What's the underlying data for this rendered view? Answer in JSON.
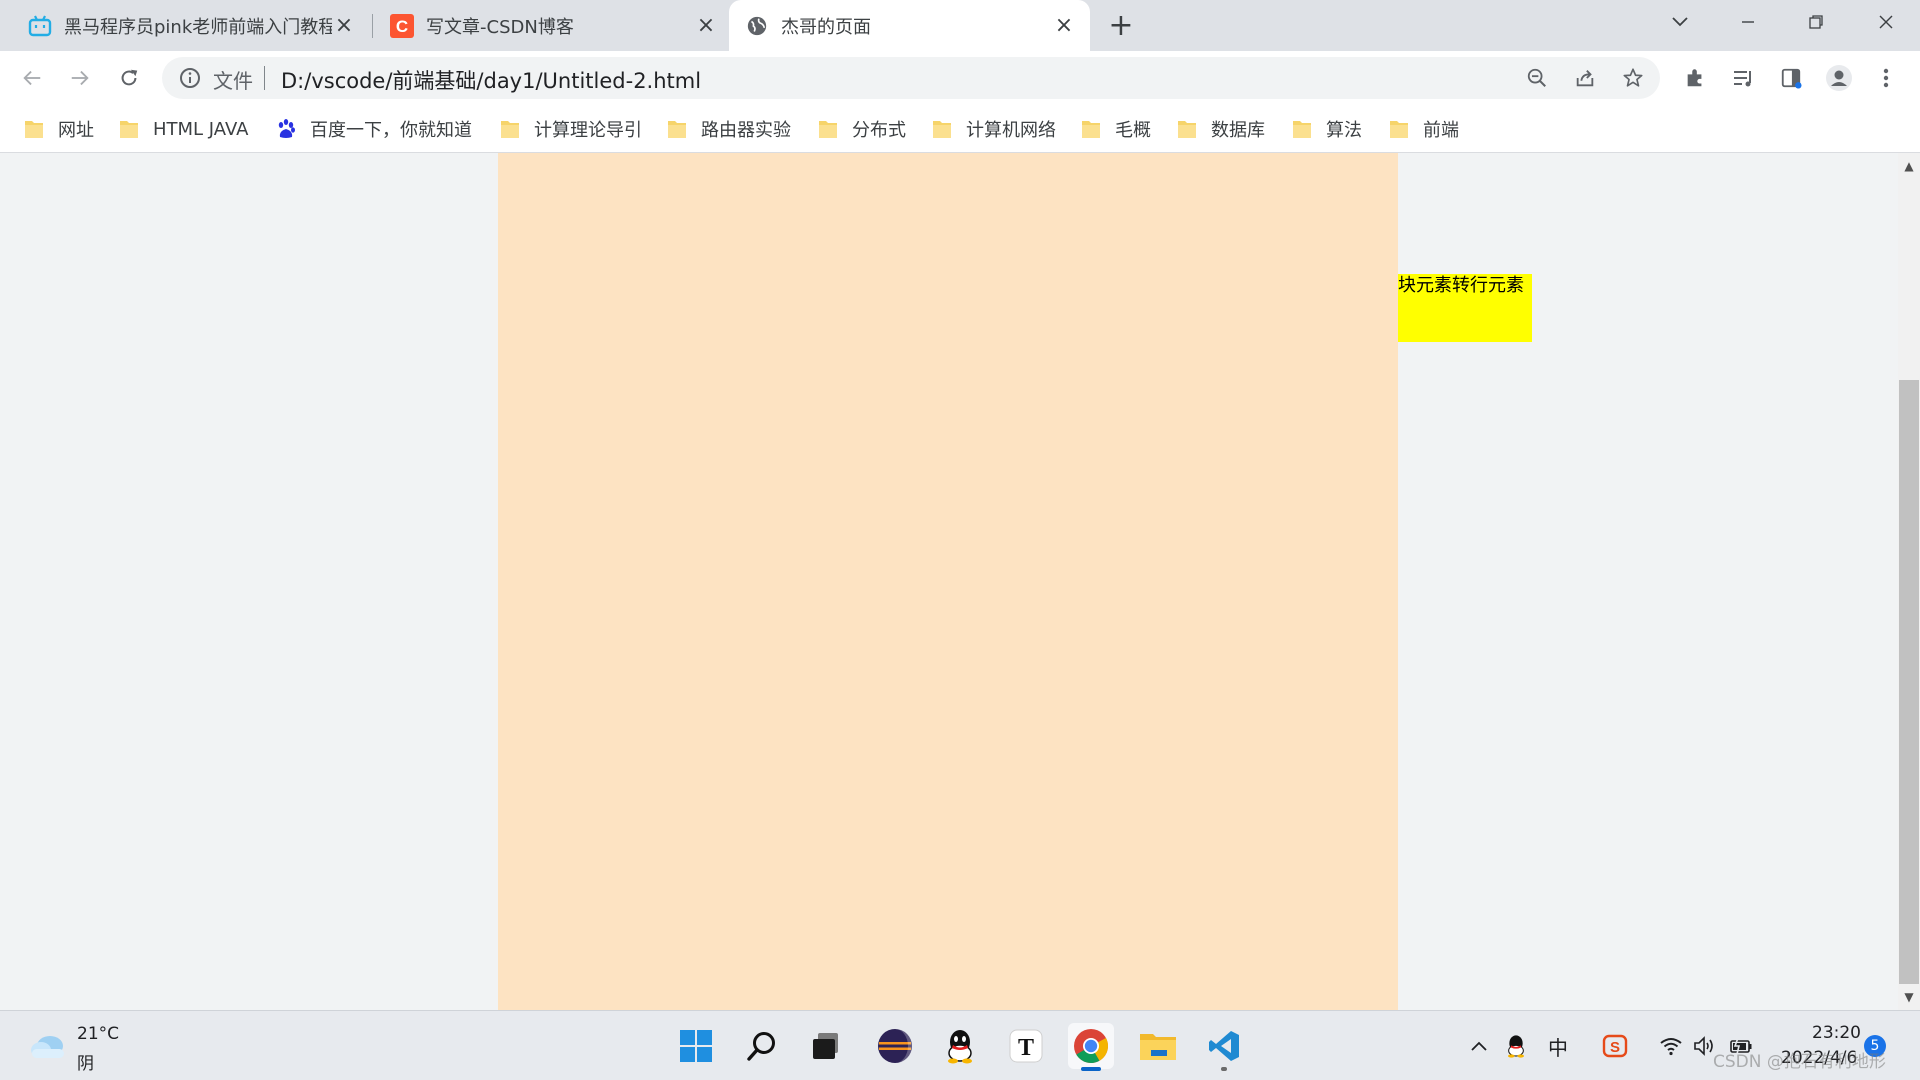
{
  "browser": {
    "tabs": [
      {
        "title": "黑马程序员pink老师前端入门教程",
        "favicon": "bilibili-icon"
      },
      {
        "title": "写文章-CSDN博客",
        "favicon": "csdn-icon"
      },
      {
        "title": "杰哥的页面",
        "favicon": "globe-icon"
      }
    ],
    "active_tab": 2,
    "address": {
      "scheme_label": "文件",
      "url": "D:/vscode/前端基础/day1/Untitled-2.html"
    },
    "bookmarks": [
      {
        "label": "网址",
        "icon": "folder-icon"
      },
      {
        "label": "HTML JAVA",
        "icon": "folder-icon"
      },
      {
        "label": "百度一下，你就知道",
        "icon": "baidu-icon"
      },
      {
        "label": "计算理论导引",
        "icon": "folder-icon"
      },
      {
        "label": "路由器实验",
        "icon": "folder-icon"
      },
      {
        "label": "分布式",
        "icon": "folder-icon"
      },
      {
        "label": "计算机网络",
        "icon": "folder-icon"
      },
      {
        "label": "毛概",
        "icon": "folder-icon"
      },
      {
        "label": "数据库",
        "icon": "folder-icon"
      },
      {
        "label": "算法",
        "icon": "folder-icon"
      },
      {
        "label": "前端",
        "icon": "folder-icon"
      }
    ]
  },
  "page": {
    "yellow_box_text": "块元素转行元素",
    "colors": {
      "big_box": "#fde3c2",
      "yellow_box": "#ffff00"
    }
  },
  "taskbar": {
    "weather": {
      "temp": "21°C",
      "desc": "阴"
    },
    "apps": [
      "windows-start-icon",
      "search-icon",
      "task-view-icon",
      "eclipse-icon",
      "qq-icon",
      "typora-icon",
      "chrome-icon",
      "file-explorer-icon",
      "vscode-icon"
    ],
    "tray": {
      "ime": "中"
    },
    "clock": {
      "time": "23:20",
      "date": "2022/4/6"
    },
    "notifications": "5"
  },
  "watermark": "CSDN @抱石有利地形"
}
